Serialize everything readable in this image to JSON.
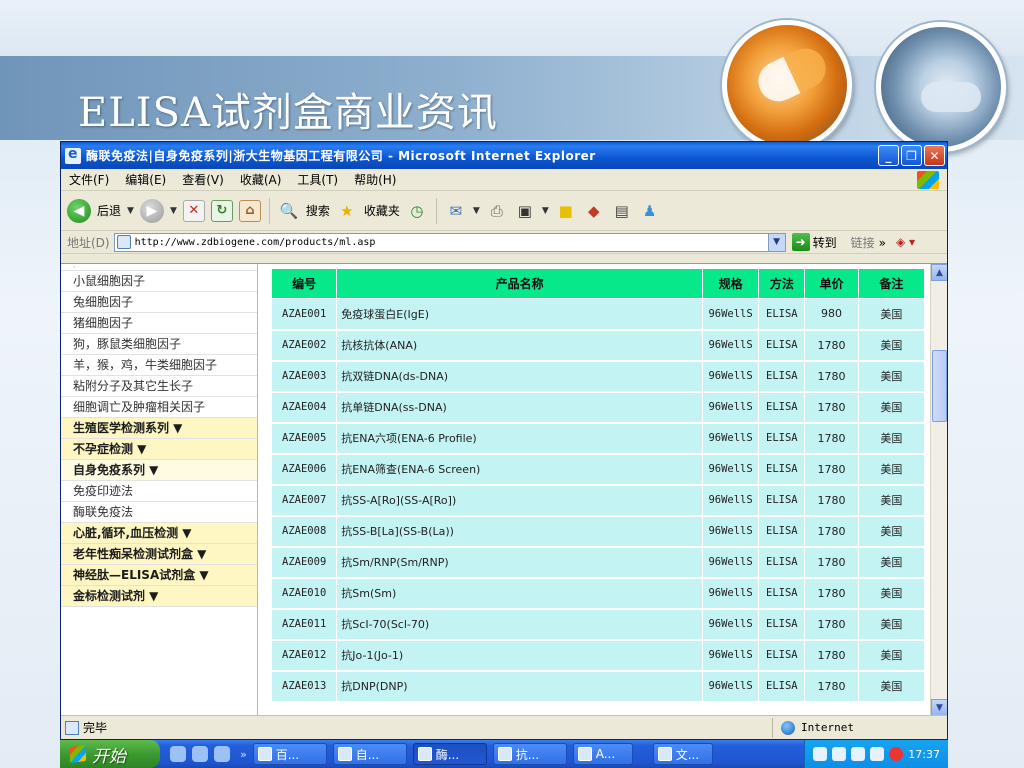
{
  "slide": {
    "title": "ELISA试剂盒商业资讯"
  },
  "window": {
    "title": "酶联免疫法|自身免疫系列|浙大生物基因工程有限公司 - Microsoft Internet Explorer",
    "controls": [
      "_",
      "❐",
      "✕"
    ]
  },
  "menu": [
    "文件(F)",
    "编辑(E)",
    "查看(V)",
    "收藏(A)",
    "工具(T)",
    "帮助(H)"
  ],
  "toolbar": {
    "back_label": "后退",
    "search_label": "搜索",
    "favorites_label": "收藏夹"
  },
  "address": {
    "label": "地址(D)",
    "url": "http://www.zdbiogene.com/products/ml.asp",
    "go_label": "转到",
    "links_label": "链接",
    "links_more": "»"
  },
  "sidebar": {
    "items": [
      {
        "label": "小鼠细胞因子",
        "type": "link"
      },
      {
        "label": "兔细胞因子",
        "type": "link"
      },
      {
        "label": "猪细胞因子",
        "type": "link"
      },
      {
        "label": "狗，豚鼠类细胞因子",
        "type": "link"
      },
      {
        "label": "羊，猴，鸡，牛类细胞因子",
        "type": "link"
      },
      {
        "label": "粘附分子及其它生长子",
        "type": "link"
      },
      {
        "label": "细胞调亡及肿瘤相关因子",
        "type": "link"
      },
      {
        "label": "生殖医学检测系列 ▼",
        "type": "category"
      },
      {
        "label": "不孕症检测 ▼",
        "type": "category"
      },
      {
        "label": "自身免疫系列 ▼",
        "type": "category"
      },
      {
        "label": "免疫印迹法",
        "type": "link"
      },
      {
        "label": "酶联免疫法",
        "type": "link"
      },
      {
        "label": "心脏,循环,血压检测 ▼",
        "type": "category"
      },
      {
        "label": "老年性痴呆检测试剂盒 ▼",
        "type": "category"
      },
      {
        "label": "神经肽—ELISA试剂盒 ▼",
        "type": "category"
      },
      {
        "label": "金标检测试剂 ▼",
        "type": "category"
      }
    ]
  },
  "table": {
    "headers": [
      "编号",
      "产品名称",
      "规格",
      "方法",
      "单价",
      "备注"
    ],
    "rows": [
      [
        "AZAE001",
        "免疫球蛋白E(IgE)",
        "96WellS",
        "ELISA",
        "980",
        "美国"
      ],
      [
        "AZAE002",
        "抗核抗体(ANA)",
        "96WellS",
        "ELISA",
        "1780",
        "美国"
      ],
      [
        "AZAE003",
        "抗双链DNA(ds-DNA)",
        "96WellS",
        "ELISA",
        "1780",
        "美国"
      ],
      [
        "AZAE004",
        "抗单链DNA(ss-DNA)",
        "96WellS",
        "ELISA",
        "1780",
        "美国"
      ],
      [
        "AZAE005",
        "抗ENA六项(ENA-6 Profile)",
        "96WellS",
        "ELISA",
        "1780",
        "美国"
      ],
      [
        "AZAE006",
        "抗ENA筛查(ENA-6 Screen)",
        "96WellS",
        "ELISA",
        "1780",
        "美国"
      ],
      [
        "AZAE007",
        "抗SS-A[Ro](SS-A[Ro])",
        "96WellS",
        "ELISA",
        "1780",
        "美国"
      ],
      [
        "AZAE008",
        "抗SS-B[La](SS-B(La))",
        "96WellS",
        "ELISA",
        "1780",
        "美国"
      ],
      [
        "AZAE009",
        "抗Sm/RNP(Sm/RNP)",
        "96WellS",
        "ELISA",
        "1780",
        "美国"
      ],
      [
        "AZAE010",
        "抗Sm(Sm)",
        "96WellS",
        "ELISA",
        "1780",
        "美国"
      ],
      [
        "AZAE011",
        "抗ScI-70(Scl-70)",
        "96WellS",
        "ELISA",
        "1780",
        "美国"
      ],
      [
        "AZAE012",
        "抗Jo-1(Jo-1)",
        "96WellS",
        "ELISA",
        "1780",
        "美国"
      ],
      [
        "AZAE013",
        "抗DNP(DNP)",
        "96WellS",
        "ELISA",
        "1780",
        "美国"
      ]
    ]
  },
  "status": {
    "text": "完毕",
    "zone": "Internet"
  },
  "taskbar": {
    "start_label": "开始",
    "tasks": [
      {
        "label": "百...",
        "active": false
      },
      {
        "label": "自...",
        "active": false
      },
      {
        "label": "酶...",
        "active": true
      },
      {
        "label": "抗...",
        "active": false
      },
      {
        "label": "A...",
        "active": false
      },
      {
        "label": "文...",
        "active": false
      }
    ],
    "clock": "17:37"
  }
}
